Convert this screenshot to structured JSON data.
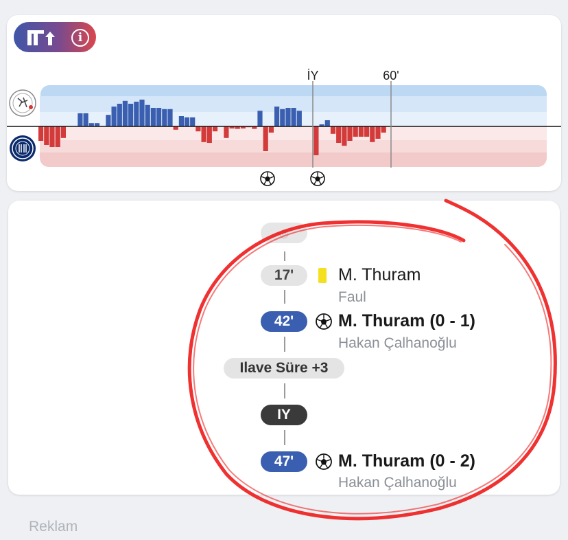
{
  "momentum": {
    "toolbar": {
      "stats_icon": "momentum-bars-up-icon",
      "info_label": "i"
    },
    "teams": {
      "home_logo": "ajax-crest-icon",
      "away_logo": "inter-crest-icon"
    },
    "markers": [
      {
        "label": "İY",
        "minute": 45
      },
      {
        "label": "60'",
        "minute": 60
      }
    ],
    "goal_icons": [
      "soccer-ball-icon",
      "soccer-ball-icon"
    ],
    "colors": {
      "home": "#3a5fb0",
      "away": "#d33a3a",
      "home_band": "#cfe3f7",
      "away_band": "#f6d3d3"
    }
  },
  "chart_data": {
    "type": "bar",
    "x_unit": "minute",
    "series": [
      {
        "values": [
          -0.35,
          -0.45,
          -0.5,
          -0.5,
          -0.28,
          0,
          0,
          0.32,
          0.32,
          0.08,
          0.08,
          0,
          0.28,
          0.48,
          0.55,
          0.62,
          0.55,
          0.6,
          0.65,
          0.52,
          0.45,
          0.45,
          0.42,
          0.42,
          -0.08,
          0.25,
          0.22,
          0.22,
          -0.12,
          -0.38,
          -0.4,
          -0.12,
          0,
          -0.28,
          -0.05,
          -0.06,
          -0.05,
          -0.02,
          -0.06,
          0.38,
          -0.6,
          -0.15,
          0.48,
          0.42,
          0.45,
          0.45,
          0.38,
          0,
          0,
          -0.7,
          0.05,
          0.15,
          -0.18,
          -0.4,
          -0.47,
          -0.35,
          -0.25,
          -0.25,
          -0.25,
          -0.38,
          -0.3,
          -0.15
        ]
      }
    ],
    "ylim": [
      -1,
      1
    ]
  },
  "events": {
    "start_icon": "whistle-icon",
    "items": [
      {
        "minute": "17'",
        "type": "yellow-card",
        "player": "M. Thuram",
        "detail": "Faul"
      },
      {
        "minute": "42'",
        "type": "goal",
        "player": "M. Thuram (0 - 1)",
        "detail": "Hakan Çalhanoğlu"
      },
      {
        "minute": "47'",
        "type": "goal",
        "player": "M. Thuram (0 - 2)",
        "detail": "Hakan Çalhanoğlu"
      }
    ],
    "added_time": "Ilave Süre +3",
    "half_time": "IY"
  },
  "footer": {
    "ad_label": "Reklam"
  },
  "annotation": {
    "color": "#ee2020"
  }
}
